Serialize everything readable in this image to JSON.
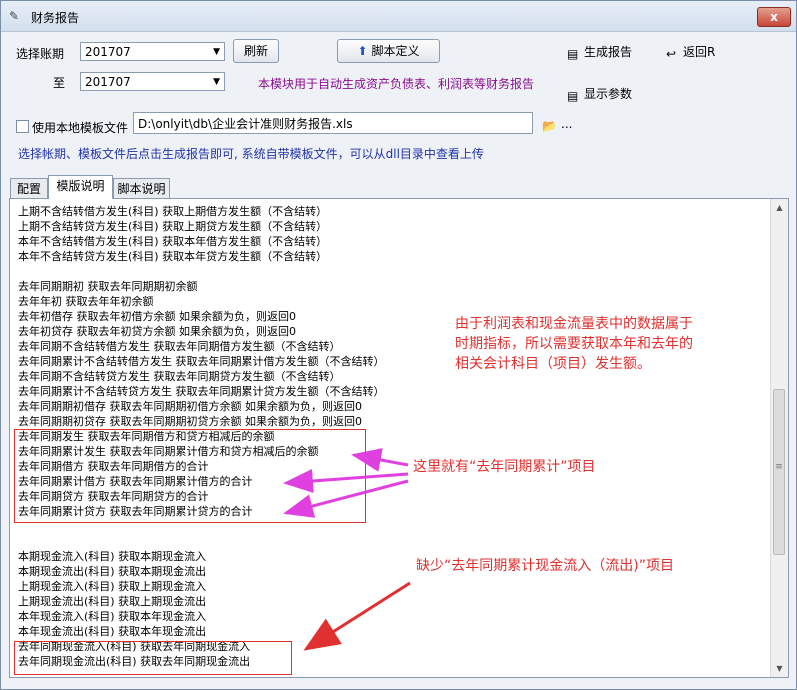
{
  "window": {
    "title": "财务报告",
    "close_label": "x"
  },
  "toolbar": {
    "period_label": "选择账期",
    "to_label": "至",
    "period_from": "201707",
    "period_to": "201707",
    "refresh_label": "刷新",
    "script_def_label": "脚本定义",
    "generate_label": "生成报告",
    "back_label": "返回R",
    "show_params_label": "显示参数",
    "module_desc": "本模块用于自动生成资产负债表、利润表等财务报告",
    "use_local_template_label": "使用本地模板文件",
    "template_path": "D:\\onlyit\\db\\企业会计准则财务报告.xls",
    "dots": "...",
    "hint": "选择帐期、模板文件后点击生成报告即可, 系统自带模板文件，可以从dll目录中查看上传"
  },
  "tabs": [
    {
      "label": "配置"
    },
    {
      "label": "模版说明"
    },
    {
      "label": "脚本说明"
    }
  ],
  "content": {
    "lines": [
      "上期不含结转借方发生(科目) 获取上期借方发生额（不含结转）",
      "上期不含结转贷方发生(科目) 获取上期贷方发生额（不含结转）",
      "本年不含结转借方发生(科目) 获取本年借方发生额（不含结转）",
      "本年不含结转贷方发生(科目) 获取本年贷方发生额（不含结转）",
      "",
      "去年同期期初  获取去年同期期初余额",
      "去年年初  获取去年年初余额",
      "去年初借存  获取去年初借方余额 如果余额为负，则返回0",
      "去年初贷存  获取去年初贷方余额 如果余额为负，则返回0",
      "去年同期不含结转借方发生 获取去年同期借方发生额（不含结转）",
      "去年同期累计不含结转借方发生 获取去年同期累计借方发生额（不含结转）",
      "去年同期不含结转贷方发生 获取去年同期贷方发生额（不含结转）",
      "去年同期累计不含结转贷方发生 获取去年同期累计贷方发生额（不含结转）",
      "去年同期期初借存  获取去年同期期初借方余额 如果余额为负，则返回0",
      "去年同期期初贷存  获取去年同期期初贷方余额 如果余额为负，则返回0",
      "去年同期发生  获取去年同期借方和贷方相减后的余额",
      "去年同期累计发生  获取去年同期累计借方和贷方相减后的余额",
      "去年同期借方  获取去年同期借方的合计",
      "去年同期累计借方  获取去年同期累计借方的合计",
      "去年同期贷方  获取去年同期贷方的合计",
      "去年同期累计贷方  获取去年同期累计贷方的合计",
      "",
      "",
      "本期现金流入(科目) 获取本期现金流入",
      "本期现金流出(科目) 获取本期现金流出",
      "上期现金流入(科目) 获取上期现金流入",
      "上期现金流出(科目) 获取上期现金流出",
      "本年现金流入(科目) 获取本年现金流入",
      "本年现金流出(科目) 获取本年现金流出",
      "去年同期现金流入(科目)   获取去年同期现金流入",
      "去年同期现金流出(科目)   获取去年同期现金流出"
    ]
  },
  "annotations": {
    "note1_l1": "由于利润表和现金流量表中的数据属于",
    "note1_l2": "时期指标，所以需要获取本年和去年的",
    "note1_l3": "相关会计科目（项目）发生额。",
    "note2": "这里就有“去年同期累计”项目",
    "note3": "缺少“去年同期累计现金流入（流出)”项目"
  },
  "colors": {
    "annotation_red": "#e03030",
    "arrow_magenta": "#e040e0",
    "hint_blue": "#2233aa",
    "desc_purple": "#8a0f8f"
  }
}
